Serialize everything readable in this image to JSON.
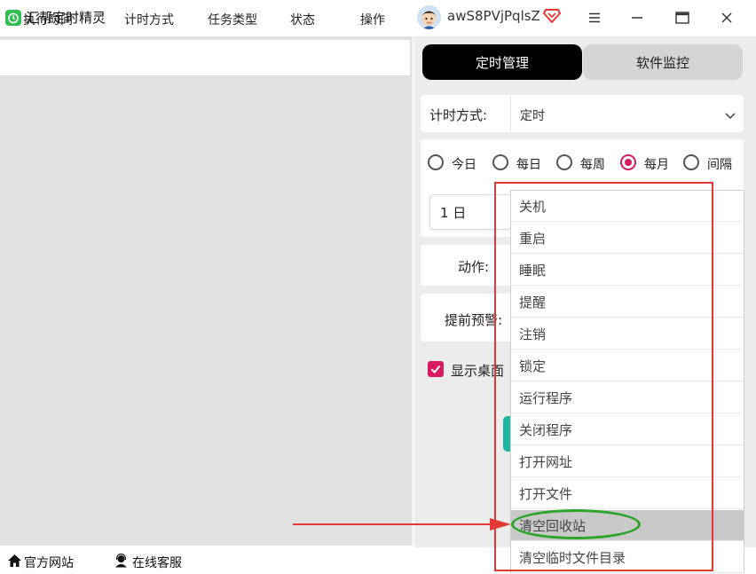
{
  "app": {
    "title": "汇帮定时精灵",
    "username": "awS8PVjPqlsZ"
  },
  "table": {
    "columns": [
      "执行时间",
      "计时方式",
      "任务类型",
      "状态",
      "操作"
    ]
  },
  "tabs": [
    {
      "label": "定时管理",
      "active": true
    },
    {
      "label": "软件监控",
      "active": false
    }
  ],
  "form": {
    "timing_label": "计时方式:",
    "timing_value": "定时",
    "frequency_options": [
      {
        "label": "今日",
        "selected": false
      },
      {
        "label": "每日",
        "selected": false
      },
      {
        "label": "每周",
        "selected": false
      },
      {
        "label": "每月",
        "selected": true
      },
      {
        "label": "间隔",
        "selected": false
      }
    ],
    "day_value": "1 日",
    "action_label": "动作:",
    "warning_label": "提前预警:",
    "desktop_label": "显示桌面",
    "desktop_checked": true
  },
  "dropdown": {
    "items": [
      "关机",
      "重启",
      "睡眠",
      "提醒",
      "注销",
      "锁定",
      "运行程序",
      "关闭程序",
      "打开网址",
      "打开文件",
      "清空回收站",
      "清空临时文件目录"
    ],
    "highlighted_index": 10
  },
  "footer": {
    "site_label": "官方网站",
    "support_label": "在线客服"
  },
  "colors": {
    "accent": "#d81b60",
    "app_logo": "#2fbf4f",
    "annotation_box": "#e53935",
    "annotation_ellipse": "#2aa52a",
    "teal_button": "#1fb5a3"
  }
}
